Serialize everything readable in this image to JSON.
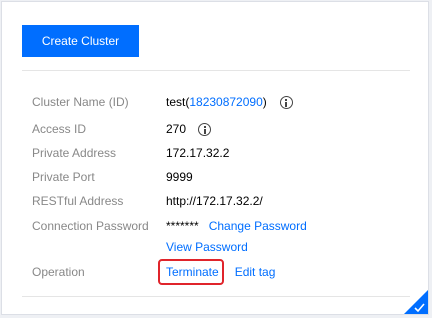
{
  "toolbar": {
    "create_label": "Create Cluster"
  },
  "details": {
    "cluster_name": {
      "label": "Cluster Name (ID)",
      "name": "test(",
      "id": "18230872090",
      "close": ")"
    },
    "access_id": {
      "label": "Access ID",
      "value": "270"
    },
    "private_address": {
      "label": "Private Address",
      "value": "172.17.32.2"
    },
    "private_port": {
      "label": "Private Port",
      "value": "9999"
    },
    "restful_address": {
      "label": "RESTful Address",
      "value": "http://172.17.32.2/"
    },
    "connection_password": {
      "label": "Connection Password",
      "value": "*******",
      "change_label": "Change Password",
      "view_label": "View Password"
    },
    "operation": {
      "label": "Operation",
      "terminate_label": "Terminate",
      "edit_tag_label": "Edit tag"
    }
  },
  "colors": {
    "accent": "#006eff",
    "highlight": "#e0242b",
    "label": "#888888"
  },
  "icons": {
    "info": "info-icon",
    "corner": "checkmark-icon"
  }
}
